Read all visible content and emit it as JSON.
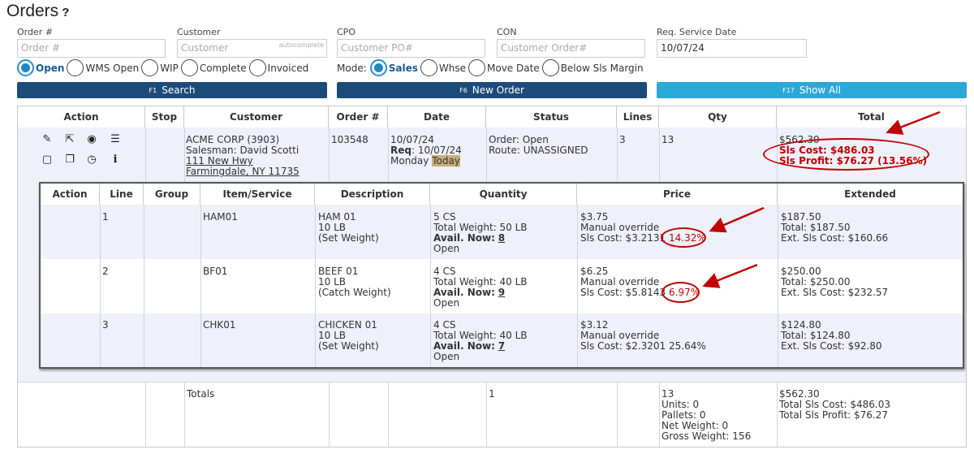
{
  "page": {
    "title": "Orders",
    "help": "?"
  },
  "filters": {
    "order": {
      "label": "Order #",
      "placeholder": "Order #"
    },
    "customer": {
      "label": "Customer",
      "placeholder": "Customer",
      "hint": "autocomplete"
    },
    "cpo": {
      "label": "CPO",
      "placeholder": "Customer PO#"
    },
    "con": {
      "label": "CON",
      "placeholder": "Customer Order#"
    },
    "service_date": {
      "label": "Req. Service Date",
      "value": "10/07/24"
    }
  },
  "status_radios": [
    "Open",
    "WMS Open",
    "WIP",
    "Complete",
    "Invoiced"
  ],
  "status_selected": "Open",
  "mode": {
    "label": "Mode:",
    "options": [
      "Sales",
      "Whse",
      "Move Date",
      "Below Sls Margin"
    ],
    "selected": "Sales"
  },
  "buttons": {
    "search": {
      "key": "F1",
      "label": "Search"
    },
    "new_order": {
      "key": "F6",
      "label": "New Order"
    },
    "show_all": {
      "key": "F17",
      "label": "Show All"
    }
  },
  "columns": [
    "Action",
    "Stop",
    "Customer",
    "Order #",
    "Date",
    "Status",
    "Lines",
    "Qty",
    "Total"
  ],
  "order": {
    "customer": "ACME CORP (3903)",
    "salesman": "Salesman: David Scotti",
    "address1": "111 New Hwy",
    "address2": "Farmingdale, NY 11735",
    "order_no": "103548",
    "date": "10/07/24",
    "req_label": "Req",
    "req_date": ": 10/07/24",
    "day": "Monday",
    "today": "Today",
    "status": "Order: Open",
    "route": "Route: UNASSIGNED",
    "lines": "3",
    "qty": "13",
    "total": "$562.30",
    "sls_cost": "Sls Cost: $486.03",
    "sls_profit": "Sls Profit: $76.27 (13.56%)"
  },
  "line_columns": [
    "Action",
    "Line",
    "Group",
    "Item/Service",
    "Description",
    "Quantity",
    "Price",
    "Extended"
  ],
  "lines": [
    {
      "line": "1",
      "item": "HAM01",
      "desc1": "HAM 01",
      "desc2": "10 LB",
      "desc3": "(Set Weight)",
      "qty": "5 CS",
      "weight": "Total Weight: 50 LB",
      "avail_label": "Avail. Now:",
      "avail": "8",
      "state": "Open",
      "price": "$3.75",
      "override": "Manual override",
      "cost": "Sls Cost: $3.2131",
      "margin": "14.32%",
      "ext": "$187.50",
      "ext_total": "Total: $187.50",
      "ext_cost": "Ext. Sls Cost: $160.66"
    },
    {
      "line": "2",
      "item": "BF01",
      "desc1": "BEEF 01",
      "desc2": "10 LB",
      "desc3": "(Catch Weight)",
      "qty": "4 CS",
      "weight": "Total Weight: 40 LB",
      "avail_label": "Avail. Now:",
      "avail": "9",
      "state": "Open",
      "price": "$6.25",
      "override": "Manual override",
      "cost": "Sls Cost: $5.8143",
      "margin": "6.97%",
      "ext": "$250.00",
      "ext_total": "Total: $250.00",
      "ext_cost": "Ext. Sls Cost: $232.57"
    },
    {
      "line": "3",
      "item": "CHK01",
      "desc1": "CHICKEN 01",
      "desc2": "10 LB",
      "desc3": "(Set Weight)",
      "qty": "4 CS",
      "weight": "Total Weight: 40 LB",
      "avail_label": "Avail. Now:",
      "avail": "7",
      "state": "Open",
      "price": "$3.12",
      "override": "Manual override",
      "cost": "Sls Cost: $2.3201",
      "margin": "25.64%",
      "ext": "$124.80",
      "ext_total": "Total: $124.80",
      "ext_cost": "Ext. Sls Cost: $92.80"
    }
  ],
  "totals": {
    "label": "Totals",
    "status_count": "1",
    "qty": "13",
    "units": "Units: 0",
    "pallets": "Pallets: 0",
    "net_weight": "Net Weight: 0",
    "gross_weight": "Gross Weight: 156",
    "total": "$562.30",
    "sls_cost": "Total Sls Cost: $486.03",
    "sls_profit": "Total Sls Profit: $76.27"
  },
  "colors": {
    "accent": "#1c4b7a",
    "show_all": "#2aa8d8",
    "annotation": "#c00000",
    "row_tint": "#eef0fa"
  }
}
